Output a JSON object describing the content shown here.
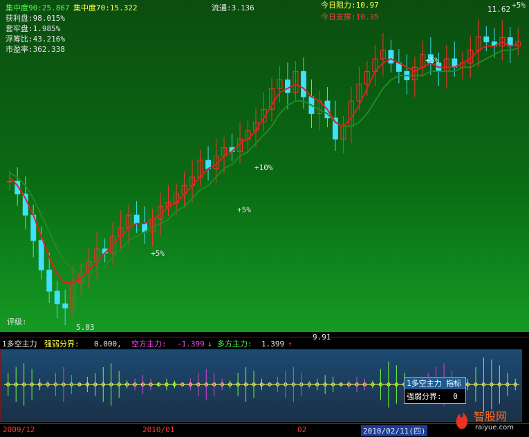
{
  "stats": {
    "concentration_90": "集中度90:25.867",
    "concentration_70": "集中度70:15.322",
    "profit_ratio": "获利盘:98.015%",
    "trapped_ratio": "套牢盘:1.985%",
    "float_chip_ratio": "浮筹比:43.216%",
    "pe_ratio": "市盈率:362.338",
    "circulation": "流通:3.136",
    "resistance_today": "今日阻力:10.97",
    "support_today": "今日支撑:10.35"
  },
  "chart_labels": {
    "high_price": "11.62",
    "low_price": "5.03",
    "low_marker": "9.91",
    "rating_label": "评级:",
    "pct_marks": [
      "+5%",
      "+5%",
      "+10%",
      "+5%",
      "+5%"
    ]
  },
  "indicator": {
    "name": "1多空主力",
    "boundary_label": "强弱分界:",
    "boundary_value": "0.000,",
    "bear_label": "空方主力:",
    "bear_value": "-1.399",
    "bear_arrow": "↓",
    "bull_label": "多方主力:",
    "bull_value": "1.399",
    "bull_arrow": "↑"
  },
  "popup": {
    "title": "1多空主力",
    "tag": "指标",
    "row_label": "强弱分界:",
    "row_value": "0"
  },
  "dates": [
    "2009/12",
    "2010/01",
    "02",
    "2010/02/11(四)"
  ],
  "watermark": {
    "cn": "智股网",
    "en": "raiyue.com"
  },
  "colors": {
    "bg_top": "#0b4d0f",
    "bg_bottom": "#159a24",
    "up": "#ff3030",
    "down": "#40e0ff",
    "ma_red": "#e02020",
    "ma_green": "#208a20"
  },
  "chart_data": {
    "type": "candlestick",
    "x": [
      "2009/12",
      "",
      "",
      "",
      "",
      "",
      "",
      "",
      "",
      "",
      "",
      "",
      "",
      "",
      "",
      "",
      "",
      "",
      "",
      "",
      "",
      "",
      "2010/01",
      "",
      "",
      "",
      "",
      "",
      "",
      "",
      "",
      "",
      "",
      "",
      "",
      "",
      "",
      "",
      "",
      "",
      "",
      "",
      "",
      "",
      "02",
      "",
      "",
      "",
      "",
      "",
      "",
      "",
      "",
      "",
      "",
      "",
      "",
      "",
      "",
      "",
      "",
      "",
      "2010/02/11(四)"
    ],
    "close": [
      8.2,
      7.9,
      7.4,
      6.8,
      6.1,
      5.6,
      5.3,
      5.2,
      5.8,
      6.0,
      6.3,
      6.6,
      6.5,
      6.9,
      7.1,
      7.4,
      7.2,
      7.0,
      7.3,
      7.6,
      7.7,
      7.9,
      8.1,
      8.3,
      8.7,
      8.5,
      8.8,
      9.0,
      8.9,
      9.2,
      9.4,
      9.6,
      9.9,
      10.4,
      10.6,
      10.3,
      10.8,
      10.2,
      9.8,
      10.1,
      9.7,
      9.2,
      9.5,
      10.1,
      10.5,
      10.8,
      11.1,
      11.3,
      11.0,
      10.8,
      10.6,
      10.9,
      11.2,
      11.0,
      10.8,
      11.1,
      10.9,
      11.0,
      11.3,
      11.62,
      11.5,
      11.4,
      11.6,
      11.4,
      11.5
    ],
    "ma_red": [
      8.3,
      8.1,
      7.8,
      7.4,
      6.9,
      6.4,
      6.0,
      5.8,
      5.8,
      5.9,
      6.1,
      6.3,
      6.5,
      6.7,
      6.9,
      7.1,
      7.2,
      7.2,
      7.3,
      7.4,
      7.6,
      7.7,
      7.9,
      8.1,
      8.3,
      8.5,
      8.6,
      8.8,
      8.9,
      9.1,
      9.2,
      9.4,
      9.7,
      10.0,
      10.3,
      10.4,
      10.5,
      10.4,
      10.2,
      10.1,
      9.9,
      9.6,
      9.5,
      9.7,
      10.0,
      10.4,
      10.8,
      11.0,
      11.1,
      11.0,
      10.9,
      10.8,
      10.9,
      11.0,
      10.9,
      10.9,
      10.9,
      11.0,
      11.1,
      11.3,
      11.4,
      11.4,
      11.5,
      11.4,
      11.45
    ],
    "ma_green": [
      8.4,
      8.3,
      8.1,
      7.8,
      7.4,
      7.0,
      6.6,
      6.3,
      6.1,
      6.0,
      6.0,
      6.1,
      6.2,
      6.4,
      6.6,
      6.8,
      6.9,
      7.0,
      7.1,
      7.2,
      7.3,
      7.5,
      7.6,
      7.8,
      8.0,
      8.1,
      8.3,
      8.5,
      8.6,
      8.8,
      8.9,
      9.1,
      9.3,
      9.5,
      9.8,
      10.0,
      10.1,
      10.1,
      10.0,
      9.9,
      9.8,
      9.6,
      9.5,
      9.5,
      9.6,
      9.8,
      10.1,
      10.4,
      10.6,
      10.7,
      10.7,
      10.7,
      10.7,
      10.8,
      10.8,
      10.8,
      10.8,
      10.9,
      10.9,
      11.0,
      11.1,
      11.2,
      11.3,
      11.3,
      11.35
    ],
    "ylim": [
      4.8,
      12.0
    ],
    "indicator": [
      0.6,
      0.9,
      1.1,
      0.8,
      0.3,
      -0.2,
      -0.6,
      -0.9,
      -0.5,
      0.1,
      0.4,
      0.6,
      0.9,
      1.1,
      0.7,
      0.2,
      -0.3,
      -0.5,
      -0.3,
      0.1,
      0.3,
      0.2,
      -0.1,
      -0.3,
      -0.6,
      -0.8,
      -0.6,
      -0.3,
      0.2,
      0.6,
      0.9,
      0.7,
      0.3,
      -0.1,
      -0.4,
      -0.7,
      -0.9,
      -0.6,
      -0.2,
      0.3,
      0.5,
      0.4,
      0.1,
      -0.2,
      -0.4,
      -0.3,
      0.2,
      0.8,
      1.2,
      1.0,
      0.6,
      0.3,
      -0.2,
      -0.6,
      -0.9,
      -1.1,
      -0.7,
      -0.2,
      0.3,
      0.9,
      1.399,
      1.3,
      1.0,
      0.6,
      0.3
    ],
    "indicator_ylim": [
      -1.6,
      1.6
    ]
  }
}
